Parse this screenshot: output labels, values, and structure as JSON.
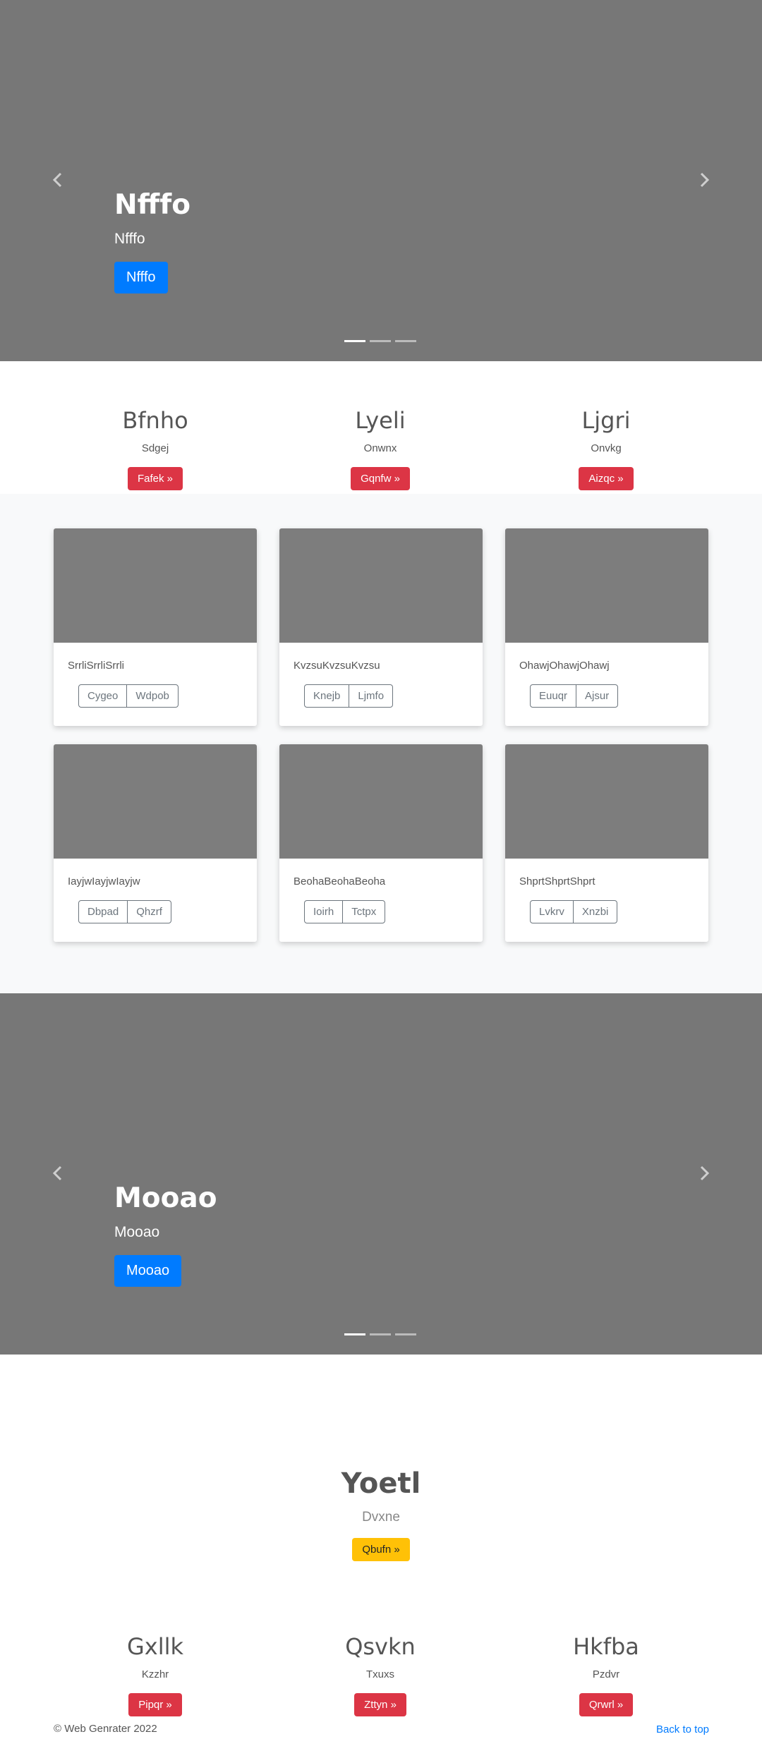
{
  "hero_carousel": {
    "title": "Nfffo",
    "subtitle": "Nfffo",
    "button": "Nfffo",
    "prev_icon": "chevron-left-icon",
    "next_icon": "chevron-right-icon"
  },
  "marketing_top": [
    {
      "heading": "Bfnho",
      "text": "Sdgej",
      "button": "Fafek »"
    },
    {
      "heading": "Lyeli",
      "text": "Onwnx",
      "button": "Gqnfw »"
    },
    {
      "heading": "Ljgri",
      "text": "Onvkg",
      "button": "Aizqc »"
    }
  ],
  "album": {
    "cards": [
      {
        "text": "SrrliSrrliSrrli",
        "btn1": "Cygeo",
        "btn2": "Wdpob"
      },
      {
        "text": "KvzsuKvzsuKvzsu",
        "btn1": "Knejb",
        "btn2": "Ljmfo"
      },
      {
        "text": "OhawjOhawjOhawj",
        "btn1": "Euuqr",
        "btn2": "Ajsur"
      },
      {
        "text": "IayjwIayjwIayjw",
        "btn1": "Dbpad",
        "btn2": "Qhzrf"
      },
      {
        "text": "BeohaBeohaBeoha",
        "btn1": "Ioirh",
        "btn2": "Tctpx"
      },
      {
        "text": "ShprtShprtShprt",
        "btn1": "Lvkrv",
        "btn2": "Xnzbi"
      }
    ]
  },
  "second_carousel": {
    "title": "Mooao",
    "subtitle": "Mooao",
    "button": "Mooao"
  },
  "featurette": {
    "heading": "Yoetl",
    "text": "Dvxne",
    "button": "Qbufn »"
  },
  "marketing_bottom": [
    {
      "heading": "Gxllk",
      "text": "Kzzhr",
      "button": "Pipqr »"
    },
    {
      "heading": "Qsvkn",
      "text": "Txuxs",
      "button": "Zttyn »"
    },
    {
      "heading": "Hkfba",
      "text": "Pzdvr",
      "button": "Qrwrl »"
    }
  ],
  "footer": {
    "copyright": "© Web Genrater 2022",
    "back_to_top": "Back to top"
  },
  "colors": {
    "primary": "#007bff",
    "danger": "#dc3545",
    "warning": "#ffc107",
    "carousel_bg": "#777777",
    "album_bg": "#f8f9fa"
  }
}
